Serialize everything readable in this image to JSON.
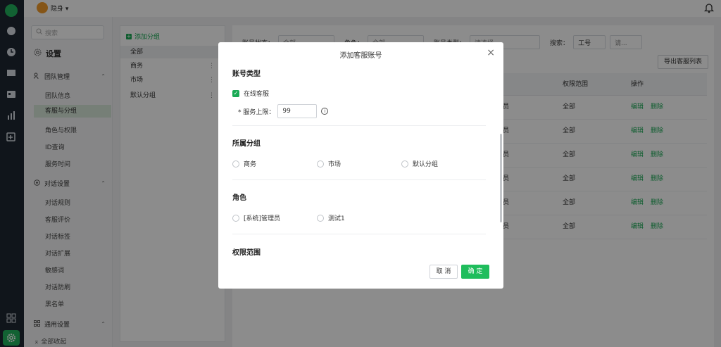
{
  "topbar": {
    "status": "隐身 ▾"
  },
  "sidebar": {
    "search_placeholder": "搜索",
    "title": "设置",
    "groups": [
      {
        "label": "团队管理",
        "items": [
          "团队信息",
          "客服与分组",
          "角色与权限",
          "ID查询",
          "服务时间"
        ]
      },
      {
        "label": "对话设置",
        "items": [
          "对话规则",
          "客服评价",
          "对话标签",
          "对话扩展",
          "敏感词",
          "对话防刷",
          "黑名单"
        ]
      },
      {
        "label": "通用设置",
        "items": []
      }
    ],
    "collapse_all": "全部收起",
    "active_item": "客服与分组"
  },
  "groups_panel": {
    "add_label": "添加分组",
    "groups": [
      "全部",
      "商务",
      "市场",
      "默认分组"
    ]
  },
  "filters": {
    "status_label": "账号状态：",
    "status_value": "全部",
    "role_label": "角色：",
    "role_value": "全部",
    "type_label": "账号类型：",
    "type_placeholder": "请选择",
    "search_label": "搜索：",
    "search_field": "工号",
    "search_placeholder": "请..."
  },
  "export_button": "导出客服列表",
  "table": {
    "headers": {
      "scope": "权限范围",
      "ops": "操作"
    },
    "rows": [
      {
        "role_tail": "员",
        "scope": "全部",
        "edit": "编辑",
        "del": "删除"
      },
      {
        "role_tail": "员",
        "scope": "全部",
        "edit": "编辑",
        "del": "删除"
      },
      {
        "role_tail": "员",
        "scope": "全部",
        "edit": "编辑",
        "del": "删除"
      },
      {
        "role_tail": "员",
        "scope": "全部",
        "edit": "编辑",
        "del": "删除"
      },
      {
        "role_tail": "员",
        "scope": "全部",
        "edit": "编辑",
        "del": "删除"
      },
      {
        "role_tail": "员",
        "scope": "全部",
        "edit": "编辑",
        "del": "删除"
      }
    ]
  },
  "modal": {
    "title": "添加客服账号",
    "section_account_type": "账号类型",
    "online_service_label": "在线客服",
    "service_limit_label": "* 服务上限：",
    "service_limit_value": "99",
    "section_group": "所属分组",
    "group_options": [
      "商务",
      "市场",
      "默认分组"
    ],
    "section_role": "角色",
    "role_options": [
      "[系统]管理员",
      "测试1"
    ],
    "section_scope": "权限范围",
    "cancel_label": "取 消",
    "ok_label": "确 定"
  },
  "colors": {
    "accent": "#1fbd5c",
    "rail": "#1e2732"
  }
}
